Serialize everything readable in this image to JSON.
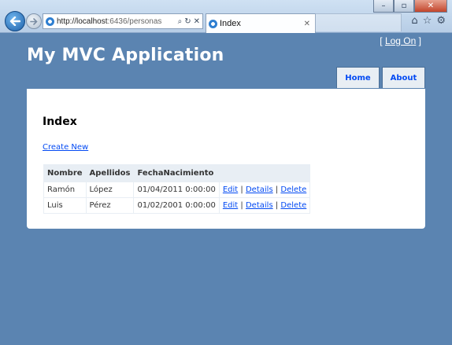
{
  "browser": {
    "address_url": "http://localhost",
    "address_url_dim": ":6436/personas",
    "tab_title": "Index",
    "tab_close": "✕",
    "titlebar": {
      "minimize": "–",
      "maximize": "▫",
      "close": "✕"
    },
    "address_icons": {
      "search": "⌕",
      "refresh": "↻",
      "stop": "✕"
    },
    "toolbar_icons": {
      "home": "⌂",
      "favorites": "☆",
      "tools": "⚙"
    }
  },
  "site": {
    "title": "My MVC Application",
    "logon": {
      "prefix": "[ ",
      "link": "Log On",
      "suffix": " ]"
    },
    "menu": [
      {
        "label": "Home"
      },
      {
        "label": "About"
      }
    ]
  },
  "content": {
    "heading": "Index",
    "create_new": "Create New",
    "table": {
      "headers": [
        "Nombre",
        "Apellidos",
        "FechaNacimiento",
        ""
      ],
      "rows": [
        {
          "nombre": "Ramón",
          "apellidos": "López",
          "fecha": "01/04/2011 0:00:00",
          "edit": "Edit",
          "details": "Details",
          "delete": "Delete",
          "sep": "|"
        },
        {
          "nombre": "Luis",
          "apellidos": "Pérez",
          "fecha": "01/02/2001 0:00:00",
          "edit": "Edit",
          "details": "Details",
          "delete": "Delete",
          "sep": "|"
        }
      ]
    }
  }
}
